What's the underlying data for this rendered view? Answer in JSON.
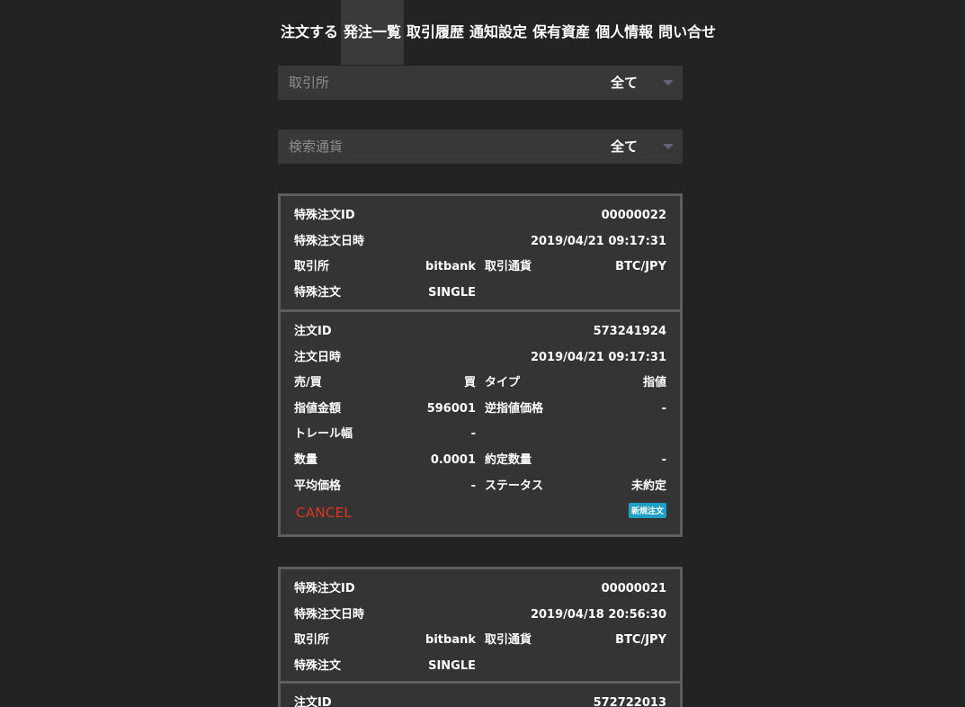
{
  "nav": {
    "tabs": [
      "注文する",
      "発注一覧",
      "取引履歴",
      "通知設定",
      "保有資産",
      "個人情報",
      "問い合せ"
    ]
  },
  "filters": {
    "exchange": {
      "label": "取引所",
      "value": "全て"
    },
    "currency": {
      "label": "検索通貨",
      "value": "全て"
    }
  },
  "labels": {
    "special_order_id": "特殊注文ID",
    "special_order_datetime": "特殊注文日時",
    "exchange": "取引所",
    "pair": "取引通貨",
    "special_order": "特殊注文",
    "order_id": "注文ID",
    "order_datetime": "注文日時",
    "side": "売/買",
    "type": "タイプ",
    "limit_price": "指値金額",
    "stop_price": "逆指値価格",
    "trail_width": "トレール幅",
    "quantity": "数量",
    "filled_quantity": "約定数量",
    "avg_price": "平均価格",
    "status": "ステータス",
    "cancel": "CANCEL"
  },
  "orders": [
    {
      "special": {
        "id": "00000022",
        "datetime": "2019/04/21 09:17:31",
        "exchange": "bitbank",
        "pair": "BTC/JPY",
        "kind": "SINGLE"
      },
      "order": {
        "id": "573241924",
        "datetime": "2019/04/21 09:17:31",
        "side": "買",
        "type": "指値",
        "limit_price": "596001",
        "stop_price": "-",
        "trail_width": "-",
        "quantity": "0.0001",
        "filled_quantity": "-",
        "avg_price": "-",
        "status": "未約定",
        "badge": "新規注文"
      }
    },
    {
      "special": {
        "id": "00000021",
        "datetime": "2019/04/18 20:56:30",
        "exchange": "bitbank",
        "pair": "BTC/JPY",
        "kind": "SINGLE"
      },
      "order": {
        "id": "572722013"
      }
    }
  ]
}
